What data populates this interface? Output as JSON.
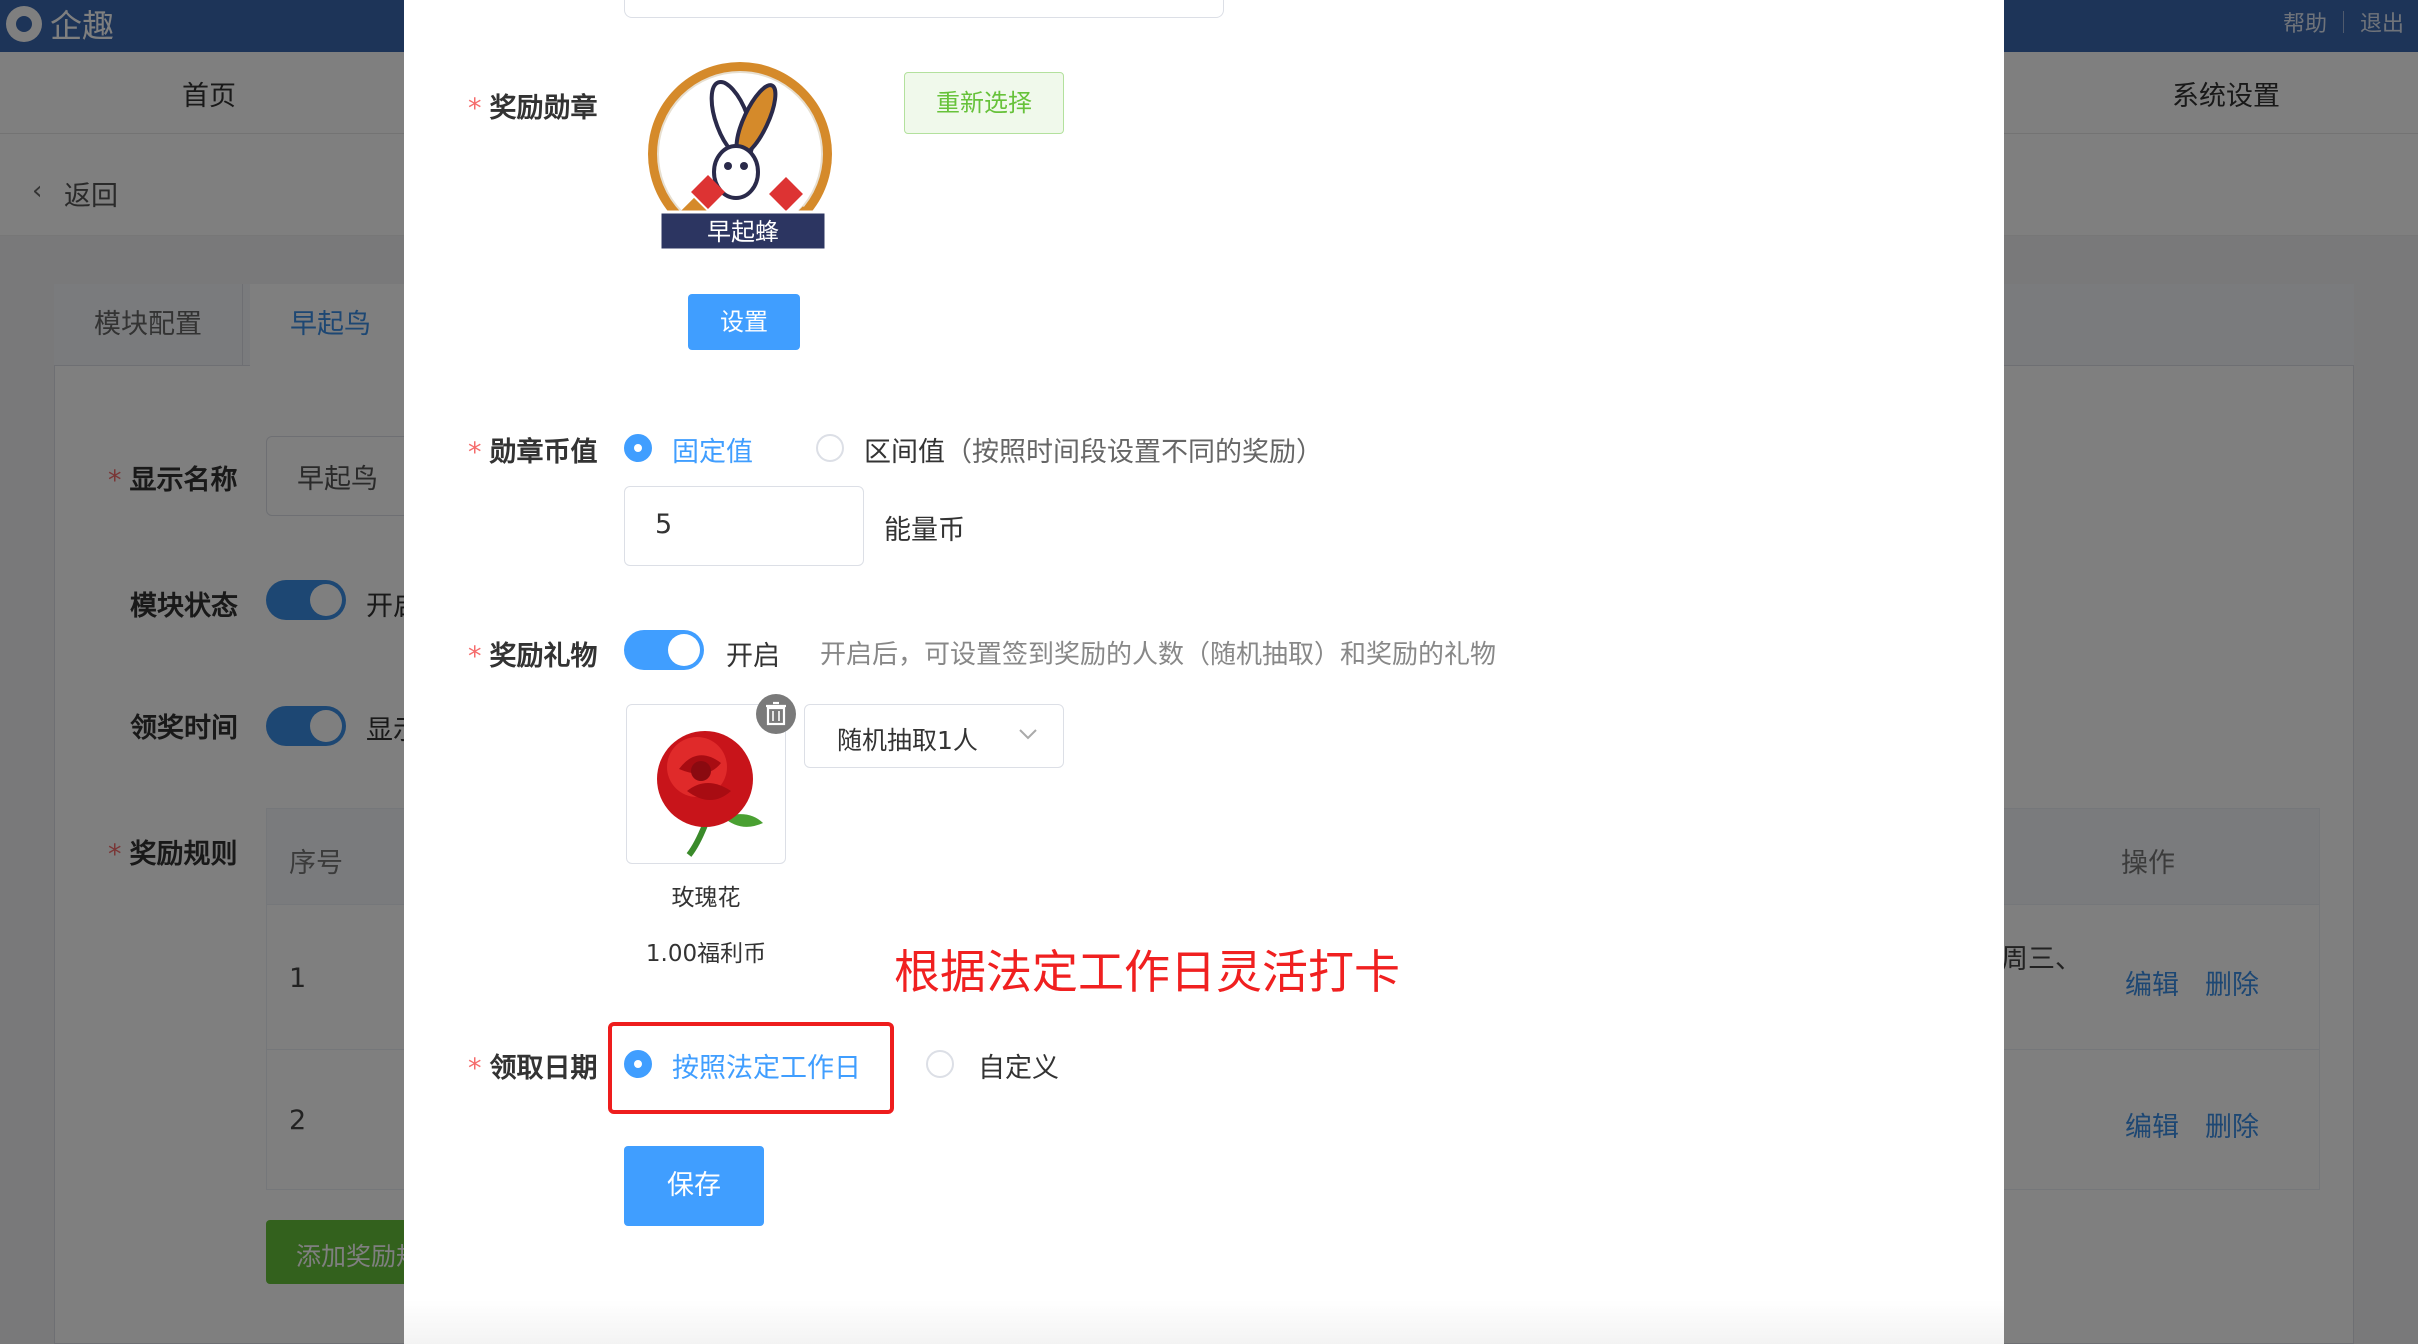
{
  "app": {
    "logo_text": "企趣",
    "links": [
      "帮助",
      "退出"
    ]
  },
  "nav": {
    "home": "首页",
    "settings": "系统设置"
  },
  "back": {
    "label": "返回"
  },
  "tabs": [
    "模块配置",
    "早起鸟"
  ],
  "bg_form": {
    "display_name_label": "显示名称",
    "display_name_value": "早起鸟",
    "module_status_label": "模块状态",
    "module_status_text": "开启",
    "claim_time_label": "领奖时间",
    "claim_time_text": "显示",
    "reward_rules_label": "奖励规则",
    "table": {
      "col_seq": "序号",
      "col_ops": "操作",
      "rows": [
        {
          "seq": "1",
          "partial": "周三、",
          "edit": "编辑",
          "delete": "删除"
        },
        {
          "seq": "2",
          "edit": "编辑",
          "delete": "删除"
        }
      ]
    },
    "add_rule_button": "添加奖励规则"
  },
  "modal": {
    "badge": {
      "label": "奖励勋章",
      "badge_name": "早起蜂",
      "reselect_button": "重新选择",
      "set_button": "设置"
    },
    "coin_value": {
      "label": "勋章币值",
      "option_fixed": "固定值",
      "option_range": "区间值",
      "option_range_hint": "（按照时间段设置不同的奖励）",
      "selected": "fixed",
      "amount": "5",
      "unit": "能量币"
    },
    "gift": {
      "label": "奖励礼物",
      "switch_on": true,
      "switch_text": "开启",
      "hint": "开启后，可设置签到奖励的人数（随机抽取）和奖励的礼物",
      "item_name": "玫瑰花",
      "item_price": "1.00福利币",
      "draw_select_value": "随机抽取1人"
    },
    "annotation": "根据法定工作日灵活打卡",
    "claim_date": {
      "label": "领取日期",
      "option_workday": "按照法定工作日",
      "option_custom": "自定义",
      "selected": "workday"
    },
    "save_button": "保存"
  },
  "colors": {
    "primary": "#409eff",
    "topbar": "#3a68b0",
    "required": "#f56c6c",
    "annotation_red": "#f02020",
    "success_green": "#67c23a"
  }
}
